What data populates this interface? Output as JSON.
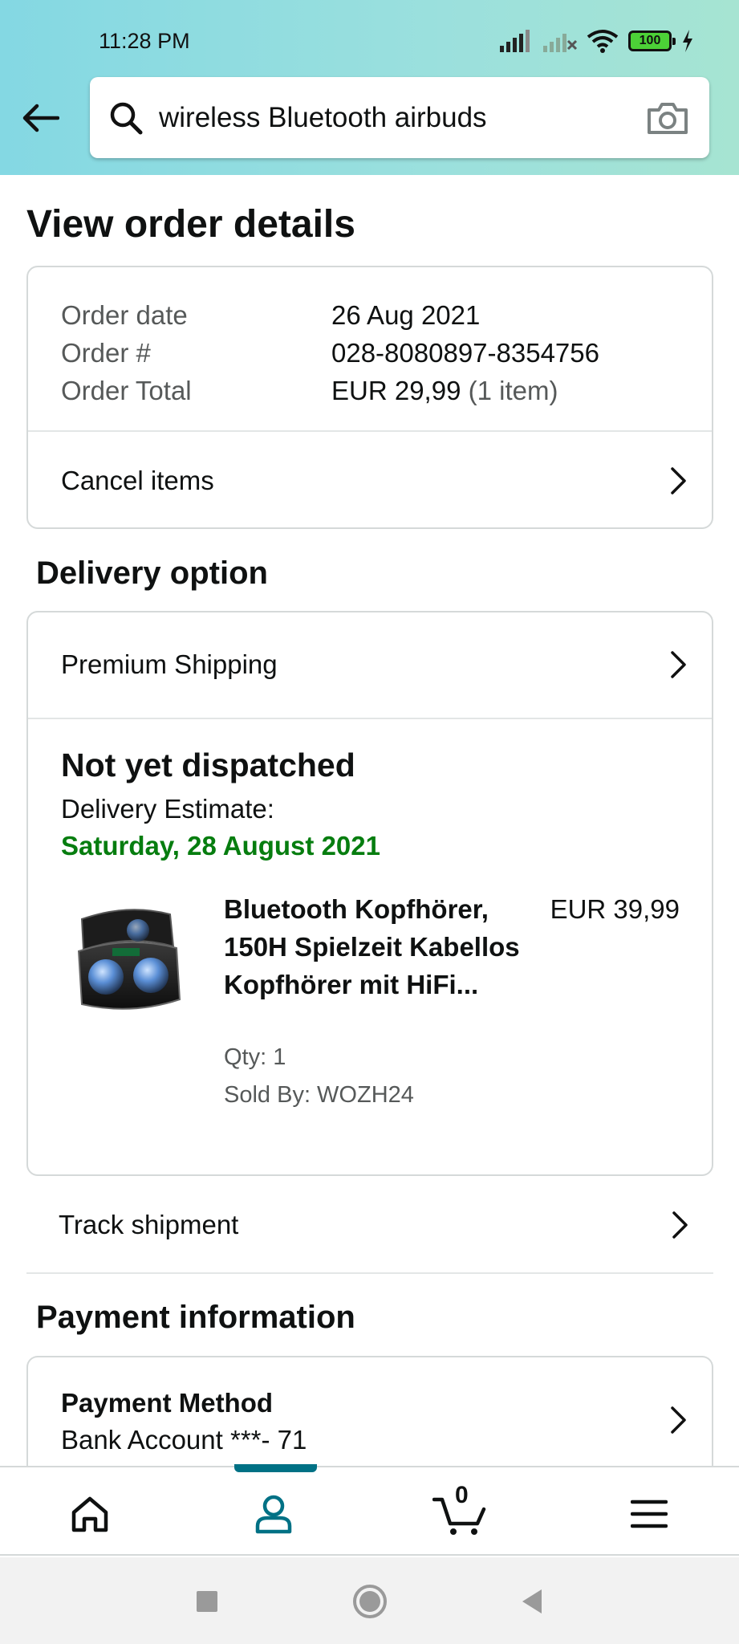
{
  "status_bar": {
    "time": "11:28 PM",
    "battery": "100"
  },
  "search": {
    "query": "wireless Bluetooth airbuds"
  },
  "page": {
    "title": "View order details"
  },
  "order": {
    "date_label": "Order date",
    "date_value": "26 Aug 2021",
    "number_label": "Order #",
    "number_value": "028-8080897-8354756",
    "total_label": "Order Total",
    "total_value": "EUR 29,99",
    "total_items": "(1 item)",
    "cancel_label": "Cancel items"
  },
  "delivery": {
    "section_title": "Delivery option",
    "shipping_label": "Premium Shipping",
    "status": "Not yet dispatched",
    "estimate_label": "Delivery Estimate:",
    "estimate_date": "Saturday, 28 August 2021",
    "product": {
      "title": "Bluetooth Kopfhörer, 150H Spielzeit Kabellos Kopfhörer mit HiFi...",
      "price": "EUR 39,99",
      "qty": "Qty: 1",
      "seller": "Sold By: WOZH24"
    },
    "track_label": "Track shipment"
  },
  "payment": {
    "section_title": "Payment information",
    "method_title": "Payment Method",
    "method_value": "Bank Account ***- 71"
  },
  "bottom_nav": {
    "cart_count": "0",
    "active": "account",
    "accent_color": "#007185"
  },
  "colors": {
    "delivery_green": "#067d0f",
    "muted_text": "#565959"
  }
}
